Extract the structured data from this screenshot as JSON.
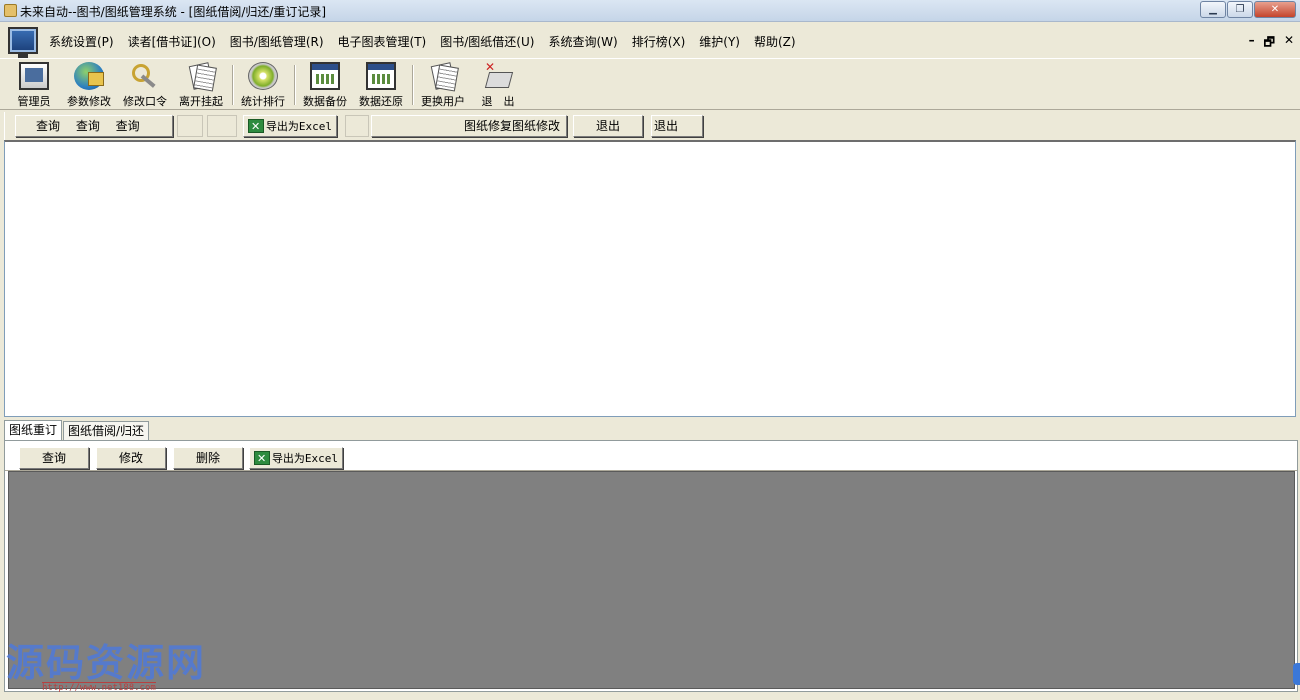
{
  "window": {
    "title": "未来自动--图书/图纸管理系统 - [图纸借阅/归还/重订记录]",
    "buttons": [
      "minimize",
      "restore",
      "close"
    ],
    "close_label": "✕"
  },
  "menu": {
    "items": [
      "系统设置(P)",
      "读者[借书证](O)",
      "图书/图纸管理(R)",
      "电子图表管理(T)",
      "图书/图纸借还(U)",
      "系统查询(W)",
      "排行榜(X)",
      "维护(Y)",
      "帮助(Z)"
    ],
    "controls": [
      "–",
      "🗗",
      "✕"
    ]
  },
  "toolbar": {
    "items": [
      {
        "label": "管理员",
        "icon": "monitor-icon"
      },
      {
        "label": "参数修改",
        "icon": "globe-icon"
      },
      {
        "label": "修改口令",
        "icon": "key-icon"
      },
      {
        "label": "离开挂起",
        "icon": "documents-icon"
      },
      {
        "label": "统计排行",
        "icon": "disc-icon"
      },
      {
        "label": "数据备份",
        "icon": "window-icon"
      },
      {
        "label": "数据还原",
        "icon": "window-icon"
      },
      {
        "label": "更换用户",
        "icon": "documents-icon"
      },
      {
        "label": "退　出",
        "icon": "exit-icon"
      }
    ]
  },
  "actions": {
    "query_group": "查询　 查询　 查询",
    "export_excel": "导出为Excel",
    "drawing_edit": "图纸修复图纸修改",
    "exit1": "退出",
    "exit2": "退出"
  },
  "tabs": [
    {
      "label": "图纸重订",
      "active": true
    },
    {
      "label": "图纸借阅/归还",
      "active": false
    }
  ],
  "sub_actions": {
    "query": "查询",
    "modify": "修改",
    "delete": "删除",
    "export_excel": "导出为Excel"
  },
  "watermark": {
    "text": "源码资源网",
    "url": "http://www.net188.com"
  },
  "colors": {
    "background": "#ece9d8",
    "grid_empty": "#808080",
    "excel_green": "#2e8b3f",
    "watermark": "#4f7ad9"
  }
}
